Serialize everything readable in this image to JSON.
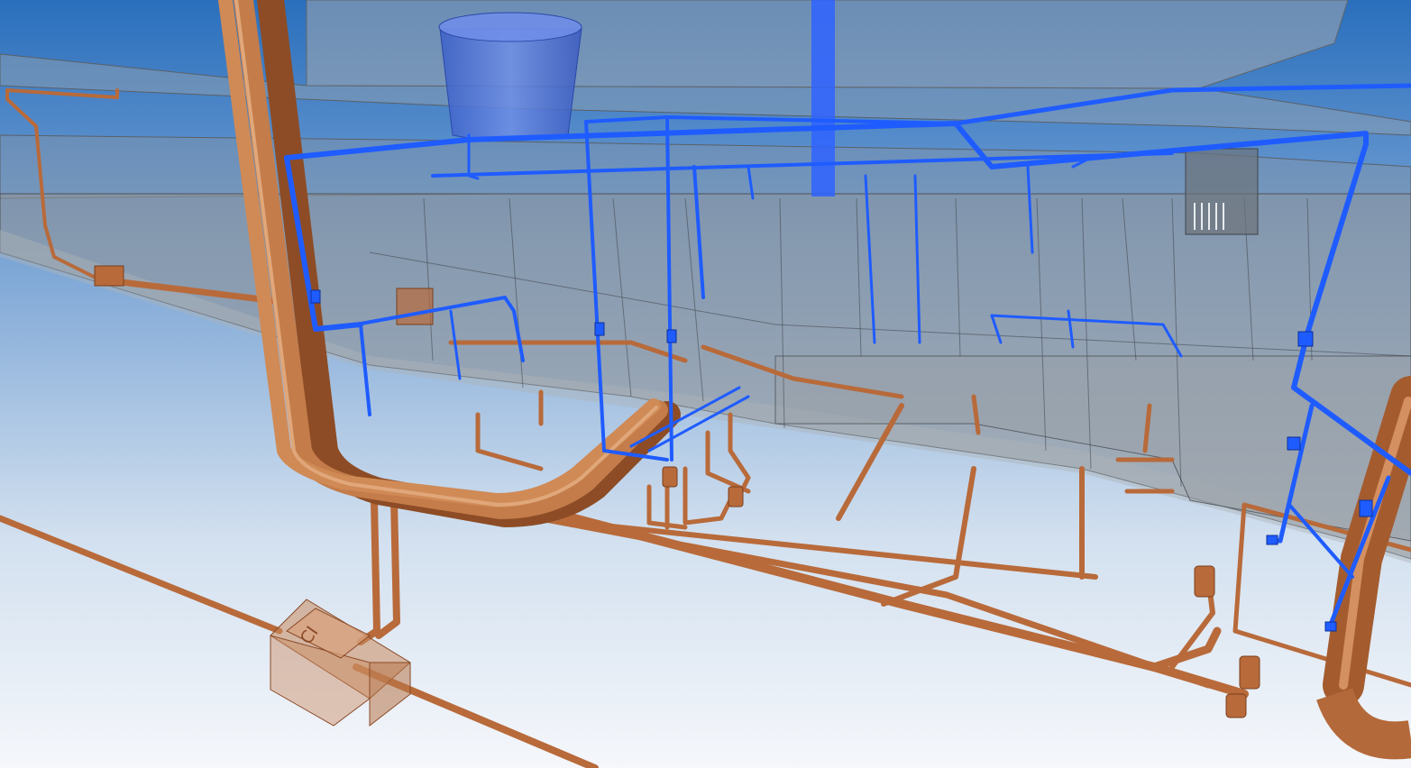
{
  "scene": {
    "inspection_box_label": "CI",
    "colors": {
      "sky_top": "#2a6fbd",
      "sky_bottom": "#f5f7fb",
      "structure_glass": "#8f9499",
      "sewer_pipe": "#b86a3a",
      "water_pipe": "#1f5cff",
      "water_tank": "#4c74e0"
    }
  }
}
